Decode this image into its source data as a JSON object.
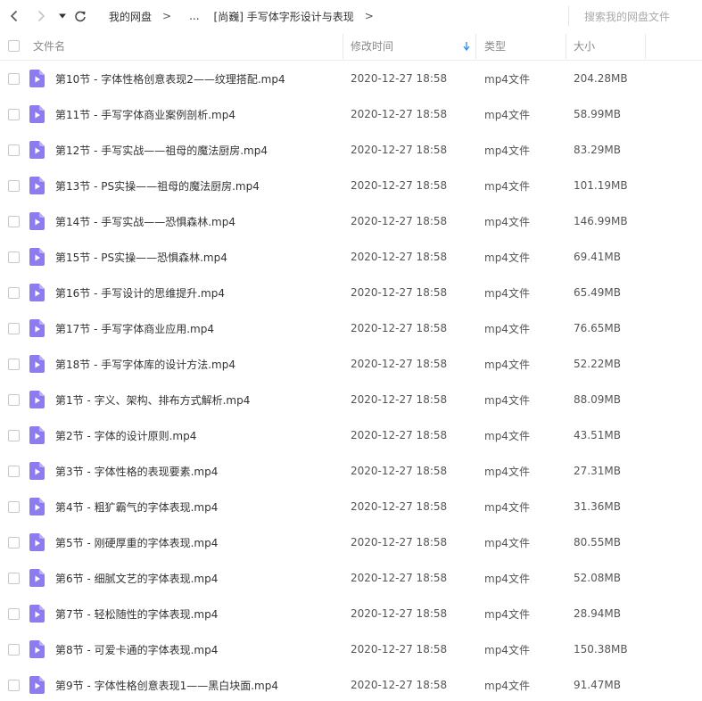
{
  "nav": {
    "breadcrumbs": [
      "我的网盘",
      "...",
      "[尚巍] 手写体字形设计与表现"
    ],
    "separator": ">",
    "search_placeholder": "搜索我的网盘文件"
  },
  "columns": {
    "name": "文件名",
    "time": "修改时间",
    "type": "类型",
    "size": "大小",
    "sorted_by": "修改时间",
    "sort_direction": "descending"
  },
  "colors": {
    "file_icon": "#8c7cf0",
    "sort_arrow": "#3a8ee6"
  },
  "files": [
    {
      "name": "第10节 - 字体性格创意表现2——纹理搭配.mp4",
      "time": "2020-12-27 18:58",
      "type": "mp4文件",
      "size": "204.28MB"
    },
    {
      "name": "第11节 - 手写字体商业案例剖析.mp4",
      "time": "2020-12-27 18:58",
      "type": "mp4文件",
      "size": "58.99MB"
    },
    {
      "name": "第12节 - 手写实战——祖母的魔法厨房.mp4",
      "time": "2020-12-27 18:58",
      "type": "mp4文件",
      "size": "83.29MB"
    },
    {
      "name": "第13节 - PS实操——祖母的魔法厨房.mp4",
      "time": "2020-12-27 18:58",
      "type": "mp4文件",
      "size": "101.19MB"
    },
    {
      "name": "第14节 - 手写实战——恐惧森林.mp4",
      "time": "2020-12-27 18:58",
      "type": "mp4文件",
      "size": "146.99MB"
    },
    {
      "name": "第15节 - PS实操——恐惧森林.mp4",
      "time": "2020-12-27 18:58",
      "type": "mp4文件",
      "size": "69.41MB"
    },
    {
      "name": "第16节 - 手写设计的思维提升.mp4",
      "time": "2020-12-27 18:58",
      "type": "mp4文件",
      "size": "65.49MB"
    },
    {
      "name": "第17节 - 手写字体商业应用.mp4",
      "time": "2020-12-27 18:58",
      "type": "mp4文件",
      "size": "76.65MB"
    },
    {
      "name": "第18节 - 手写字体库的设计方法.mp4",
      "time": "2020-12-27 18:58",
      "type": "mp4文件",
      "size": "52.22MB"
    },
    {
      "name": "第1节 - 字义、架构、排布方式解析.mp4",
      "time": "2020-12-27 18:58",
      "type": "mp4文件",
      "size": "88.09MB"
    },
    {
      "name": "第2节 - 字体的设计原则.mp4",
      "time": "2020-12-27 18:58",
      "type": "mp4文件",
      "size": "43.51MB"
    },
    {
      "name": "第3节 - 字体性格的表现要素.mp4",
      "time": "2020-12-27 18:58",
      "type": "mp4文件",
      "size": "27.31MB"
    },
    {
      "name": "第4节 - 粗犷霸气的字体表现.mp4",
      "time": "2020-12-27 18:58",
      "type": "mp4文件",
      "size": "31.36MB"
    },
    {
      "name": "第5节 - 刚硬厚重的字体表现.mp4",
      "time": "2020-12-27 18:58",
      "type": "mp4文件",
      "size": "80.55MB"
    },
    {
      "name": "第6节 - 细腻文艺的字体表现.mp4",
      "time": "2020-12-27 18:58",
      "type": "mp4文件",
      "size": "52.08MB"
    },
    {
      "name": "第7节 - 轻松随性的字体表现.mp4",
      "time": "2020-12-27 18:58",
      "type": "mp4文件",
      "size": "28.94MB"
    },
    {
      "name": "第8节 - 可爱卡通的字体表现.mp4",
      "time": "2020-12-27 18:58",
      "type": "mp4文件",
      "size": "150.38MB"
    },
    {
      "name": "第9节 - 字体性格创意表现1——黑白块面.mp4",
      "time": "2020-12-27 18:58",
      "type": "mp4文件",
      "size": "91.47MB"
    }
  ]
}
